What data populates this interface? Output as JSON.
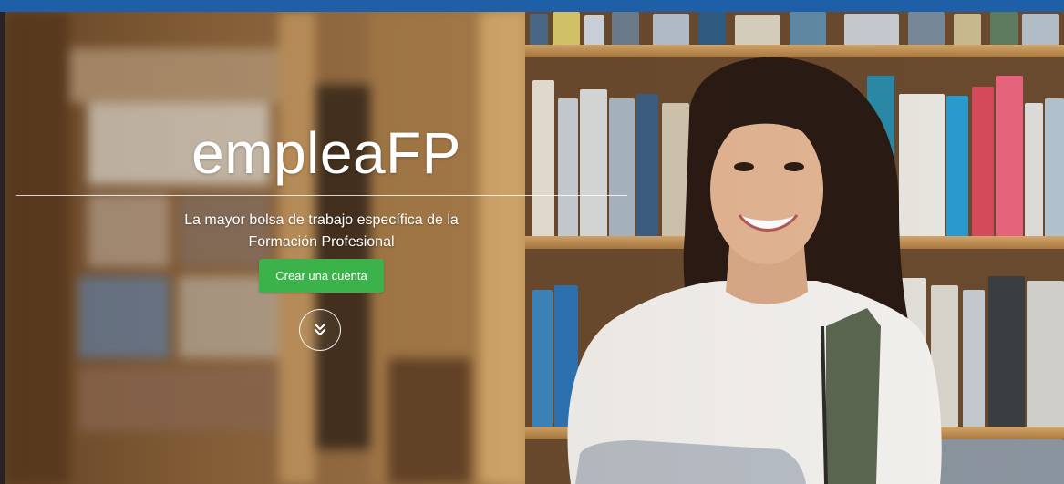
{
  "hero": {
    "brand": "empleaFP",
    "tagline_line1": "La mayor bolsa de trabajo específica de la",
    "tagline_line2": "Formación Profesional",
    "cta_label": "Crear una cuenta",
    "scroll_icon": "double-chevron-down-icon"
  },
  "colors": {
    "topbar": "#1f5fa8",
    "cta": "#3cb34a",
    "text": "#ffffff"
  }
}
